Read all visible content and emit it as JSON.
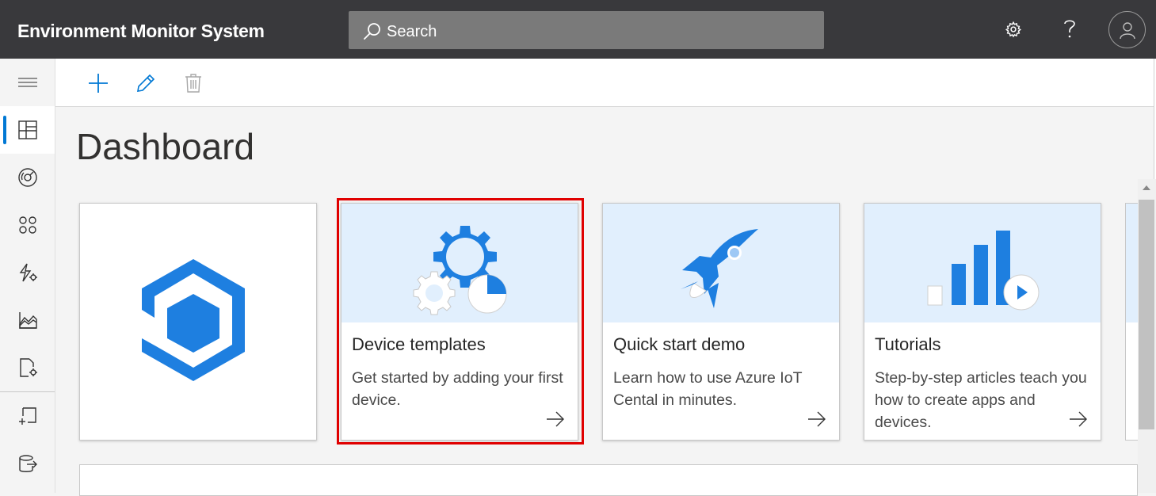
{
  "header": {
    "app_title": "Environment Monitor System",
    "search_placeholder": "Search",
    "icons": [
      "search-icon",
      "settings-gear-icon",
      "help-icon",
      "user-avatar-icon"
    ]
  },
  "left_nav": {
    "items": [
      {
        "name": "hamburger-menu",
        "icon": "menu-icon"
      },
      {
        "name": "dashboard",
        "icon": "dashboard-icon",
        "active": true
      },
      {
        "name": "devices",
        "icon": "devices-gauge-icon"
      },
      {
        "name": "device-groups",
        "icon": "device-groups-icon"
      },
      {
        "name": "rules",
        "icon": "rules-icon"
      },
      {
        "name": "analytics",
        "icon": "analytics-icon"
      },
      {
        "name": "jobs",
        "icon": "jobs-icon"
      },
      {
        "name": "device-templates",
        "icon": "device-templates-icon"
      },
      {
        "name": "data-export",
        "icon": "data-export-icon"
      }
    ]
  },
  "command_bar": {
    "icons": [
      "add-icon",
      "edit-pencil-icon",
      "delete-trash-icon"
    ]
  },
  "main": {
    "page_title": "Dashboard",
    "cards": [
      {
        "id": "logo",
        "icon": "iot-central-logo-icon"
      },
      {
        "id": "device-templates",
        "title": "Device templates",
        "description": "Get started by adding your first device.",
        "icon": "gears-icon",
        "highlighted": true
      },
      {
        "id": "quick-start-demo",
        "title": "Quick start demo",
        "description": "Learn how to use Azure IoT Cental in minutes.",
        "icon": "rocket-icon"
      },
      {
        "id": "tutorials",
        "title": "Tutorials",
        "description": "Step-by-step articles teach you how to create apps and devices.",
        "icon": "bar-chart-play-icon"
      }
    ]
  },
  "colors": {
    "topbar": "#39393c",
    "accent": "#0078d4",
    "highlight": "#e00000",
    "hero_background": "#e1effd"
  }
}
